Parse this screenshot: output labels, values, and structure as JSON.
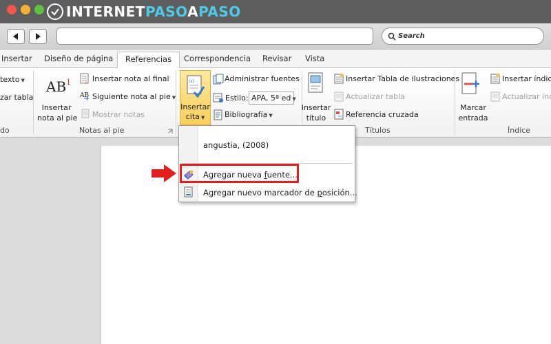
{
  "brand": {
    "part1": "INTERNET",
    "part2": "PASO",
    "part3": "A",
    "part4": "PASO"
  },
  "browser": {
    "search_placeholder": "Search"
  },
  "tabs": [
    {
      "label": "Insertar"
    },
    {
      "label": "Diseño de página"
    },
    {
      "label": "Referencias",
      "active": true
    },
    {
      "label": "Correspondencia"
    },
    {
      "label": "Revisar"
    },
    {
      "label": "Vista"
    }
  ],
  "ribbon": {
    "tabla_contenido": {
      "agregar_texto": "texto",
      "actualizar_tabla": "zar tabla",
      "group_label": "do"
    },
    "notas_al_pie": {
      "insertar_nota_pie_line1": "Insertar",
      "insertar_nota_pie_line2": "nota al pie",
      "insertar_nota_final": "Insertar nota al final",
      "siguiente_nota_pie": "Siguiente nota al pie",
      "mostrar_notas": "Mostrar notas",
      "group_label": "Notas al pie"
    },
    "citas": {
      "insertar_cita_line1": "Insertar",
      "insertar_cita_line2": "cita",
      "administrar_fuentes": "Administrar fuentes",
      "estilo_label": "Estilo:",
      "estilo_value": "APA, 5ª ed",
      "bibliografia": "Bibliografía"
    },
    "titulos": {
      "insertar_titulo_line1": "Insertar",
      "insertar_titulo_line2": "título",
      "insertar_tabla_ilustraciones": "Insertar Tabla de ilustraciones",
      "actualizar_tabla": "Actualizar tabla",
      "referencia_cruzada": "Referencia cruzada",
      "group_label": "Títulos"
    },
    "indice": {
      "marcar_entrada_line1": "Marcar",
      "marcar_entrada_line2": "entrada",
      "insertar_indice": "Insertar índice",
      "actualizar_indice": "Actualizar índi",
      "group_label": "Índice"
    }
  },
  "cita_menu": {
    "items": [
      {
        "label": "angustia, (2008)"
      },
      {
        "label_pre": "Agregar nueva ",
        "label_u": "f",
        "label_post": "uente..."
      },
      {
        "label_pre": "Agregar nuevo marcador de ",
        "label_u": "p",
        "label_post": "osición..."
      }
    ]
  },
  "colors": {
    "highlight": "#e02020",
    "brand_accent": "#4ec9e6",
    "active_button": "#f8cf5c"
  },
  "icons": [
    "close-dot",
    "minimize-dot",
    "maximize-dot",
    "back-arrow-icon",
    "forward-arrow-icon",
    "search-icon",
    "red-arrow-icon"
  ]
}
